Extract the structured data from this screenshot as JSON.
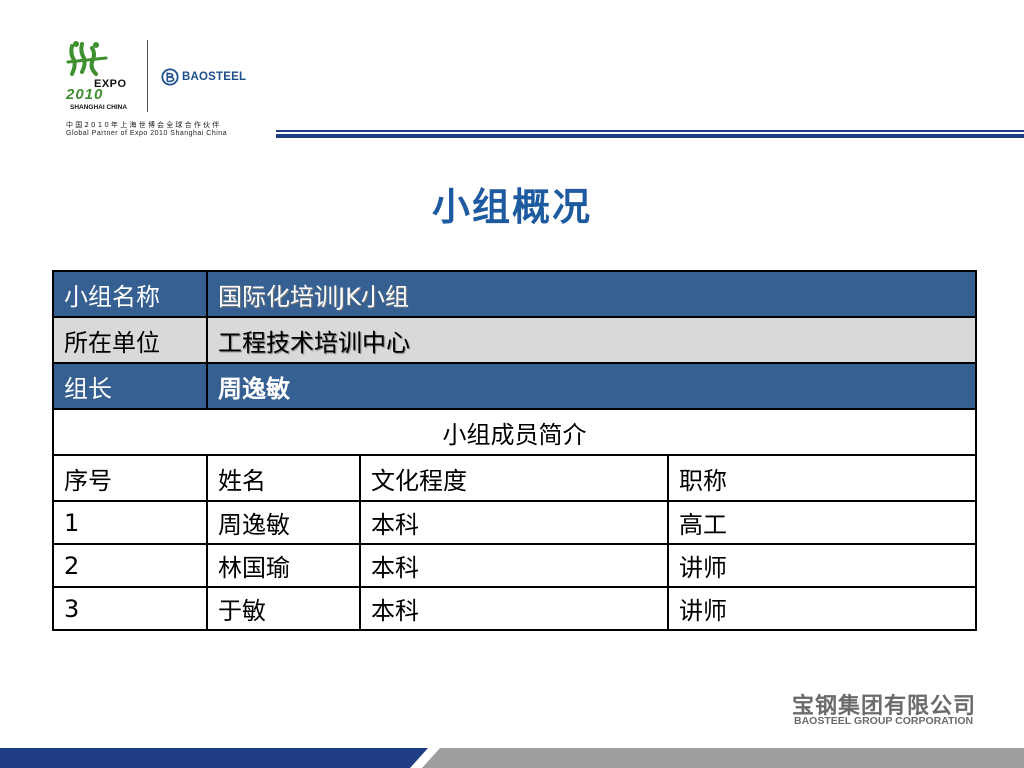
{
  "header": {
    "expo_word": "EXPO",
    "expo_year": "2010",
    "expo_city": "SHANGHAI CHINA",
    "baosteel_word": "BAOSTEEL",
    "partner_cn": "中国2010年上海世博会全球合作伙伴",
    "partner_en": "Global Partner of Expo 2010 Shanghai China",
    "rule_color": "#1f3d82"
  },
  "title": "小组概况",
  "group": {
    "name_label": "小组名称",
    "name_value": "国际化培训JK小组",
    "unit_label": "所在单位",
    "unit_value": "工程技术培训中心",
    "leader_label": "组长",
    "leader_value": "周逸敏",
    "members_heading": "小组成员简介"
  },
  "members": {
    "headers": [
      "序号",
      "姓名",
      "文化程度",
      "职称"
    ],
    "rows": [
      [
        "1",
        "周逸敏",
        "本科",
        "高工"
      ],
      [
        "2",
        "林国瑜",
        "本科",
        "讲师"
      ],
      [
        "3",
        "于敏",
        "本科",
        "讲师"
      ]
    ]
  },
  "footer": {
    "company_cn": "宝钢集团有限公司",
    "company_en": "BAOSTEEL GROUP CORPORATION"
  },
  "colors": {
    "title": "#1e5aa0",
    "row_blue": "#366092",
    "row_grey": "#d9d9d9",
    "footer_blue": "#1f3d82",
    "footer_grey": "#9e9e9e"
  }
}
